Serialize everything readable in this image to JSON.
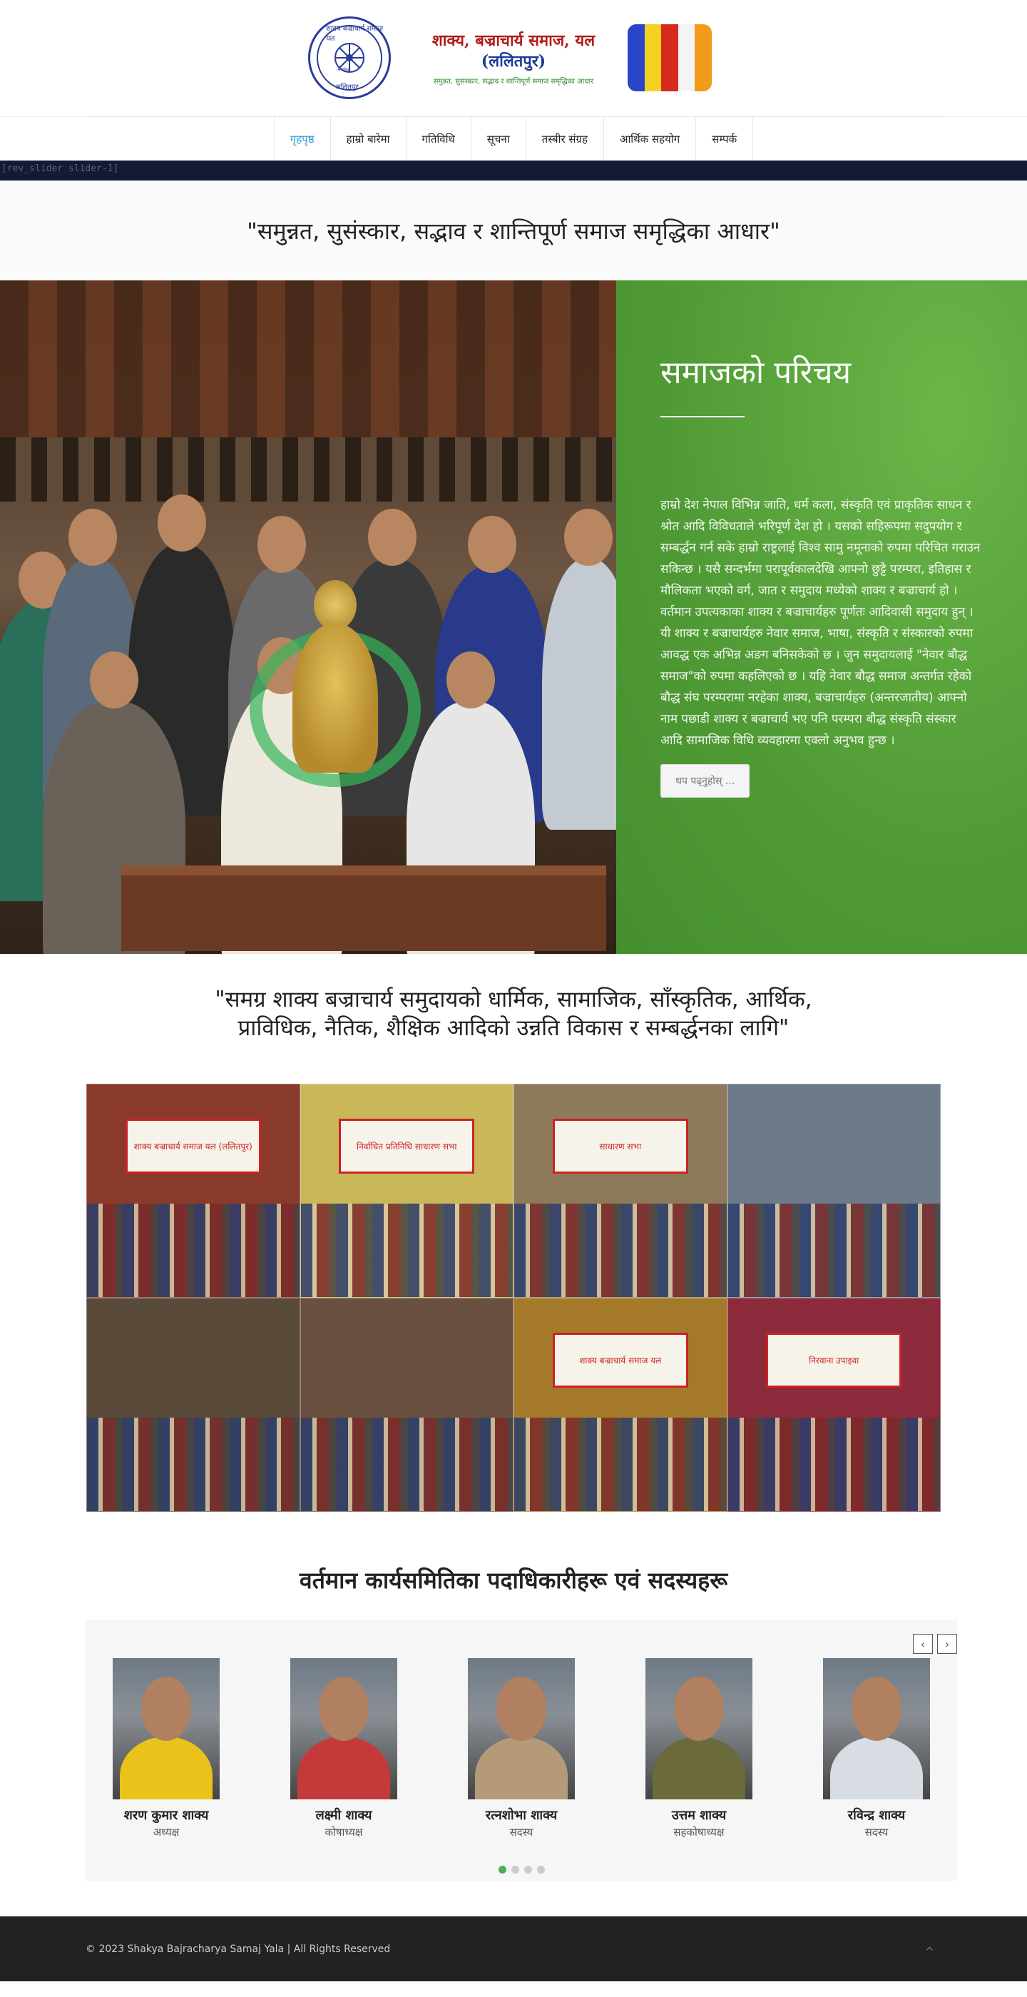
{
  "header": {
    "seal_top": "शाक्य बज्राचार्य समाज यल",
    "seal_year": "२०७८",
    "seal_bottom": "ललितपुर",
    "title": "शाक्य, बज्राचार्य समाज, यल",
    "subtitle": "(ललितपुर)",
    "tagline": "समुन्नत, सुसंस्कार, सद्भाव र शान्तिपूर्ण समाज समृद्धिका आधार",
    "flag_colors": [
      "#2b45c9",
      "#f4d21f",
      "#d62a1f",
      "#f4f4f4",
      "#f29a1a"
    ]
  },
  "nav": {
    "items": [
      {
        "label": "गृहपृष्ठ"
      },
      {
        "label": "हाम्रो बारेमा"
      },
      {
        "label": "गतिविधि"
      },
      {
        "label": "सूचना"
      },
      {
        "label": "तस्बीर संग्रह"
      },
      {
        "label": "आर्थिक सहयोग"
      },
      {
        "label": "सम्पर्क"
      }
    ],
    "active_color": "#2a9ad6"
  },
  "slider_placeholder": "[rev_slider slider-1]",
  "quote1": "\"समुन्नत, सुसंस्कार, सद्भाव र शान्तिपूर्ण समाज समृद्धिका आधार\"",
  "intro": {
    "title": "समाजको परिचय",
    "para1": "हाम्रो देश नेपाल विभिन्न जाति, धर्म कला, संस्कृति एवं प्राकृतिक साधन र श्रोत आदि विविधताले भरिपूर्ण देश हो । यसको सहिरूपमा सदुपयोग र सम्बर्द्धन गर्न सके हाम्रो राष्ट्रलाई विश्व सामु नमूनाको रुपमा परिचित गराउन सकिन्छ । यसै सन्दर्भमा परापूर्वकालदेखि आफ्नो छुट्टै परम्परा, इतिहास र मौलिकता भएको वर्ग, जात र समुदाय मध्येको शाक्य र बज्राचार्य हो ।",
    "para2": "वर्तमान उपत्यकाका शाक्य र बज्राचार्यहरु पूर्णतः आदिवासी समुदाय हुन् । यी शाक्य र बज्राचार्यहरु नेवार समाज, भाषा, संस्कृति र संस्कारको रुपमा आवद्ध एक अभिन्न अङग बनिसकेको छ । जुन समुदायलाई \"नेवार बौद्ध समाज\"को रुपमा कहलिएको छ । यहि नेवार बौद्ध समाज अन्तर्गत रहेको बौद्ध संघ परम्परामा नरहेका शाक्य, बज्राचार्यहरु (अन्तरजातीय) आफ्नो नाम पछाडी शाक्य र बज्राचार्य भए पनि परम्परा बौद्ध संस्कृति संस्कार आदि सामाजिक विधि व्यवहारमा एक्लो अनुभव हुन्छ ।",
    "button": "थप पढ्नुहोस् ..."
  },
  "quote2_line1": "\"समग्र शाक्य बज्राचार्य समुदायको धार्मिक, सामाजिक, साँस्कृतिक, आर्थिक,",
  "quote2_line2": "प्राविधिक, नैतिक, शैक्षिक आदिको उन्नति विकास र सम्बर्द्धनका लागि\"",
  "gallery": [
    {
      "caption": "शाक्य बज्राचार्य समाज यल (ललितपुर)",
      "bg": "#8a3a2a"
    },
    {
      "caption": "निर्वाचित प्रतिनिधि साधारण सभा",
      "bg": "#c9b85a"
    },
    {
      "caption": "साधारण सभा",
      "bg": "#8d7a5a"
    },
    {
      "caption": "",
      "bg": "#6c7a8a"
    },
    {
      "caption": "",
      "bg": "#5a4a3a"
    },
    {
      "caption": "",
      "bg": "#6a5040"
    },
    {
      "caption": "शाक्य बज्राचार्य समाज यल",
      "bg": "#a47a2a"
    },
    {
      "caption": "निरवाना उपाइवा",
      "bg": "#8a2a3a"
    }
  ],
  "committee": {
    "title": "वर्तमान कार्यसमितिका पदाधिकारीहरू एवं सदस्यहरू",
    "prev": "‹",
    "next": "›",
    "members": [
      {
        "name": "शरण कुमार शाक्य",
        "role": "अध्यक्ष",
        "accent": "#e9c21a"
      },
      {
        "name": "लक्ष्मी शाक्य",
        "role": "कोषाध्यक्ष",
        "accent": "#c43a3a"
      },
      {
        "name": "रत्नशोभा शाक्य",
        "role": "सदस्य",
        "accent": "#b59a7a"
      },
      {
        "name": "उत्तम शाक्य",
        "role": "सहकोषाध्यक्ष",
        "accent": "#6a6a3a"
      },
      {
        "name": "रविन्द्र शाक्य",
        "role": "सदस्य",
        "accent": "#d8dde4"
      }
    ],
    "dots_total": 4,
    "dots_active": 1
  },
  "footer": {
    "copyright": "© 2023 Shakya Bajracharya Samaj Yala | All Rights Reserved",
    "to_top": "^"
  }
}
